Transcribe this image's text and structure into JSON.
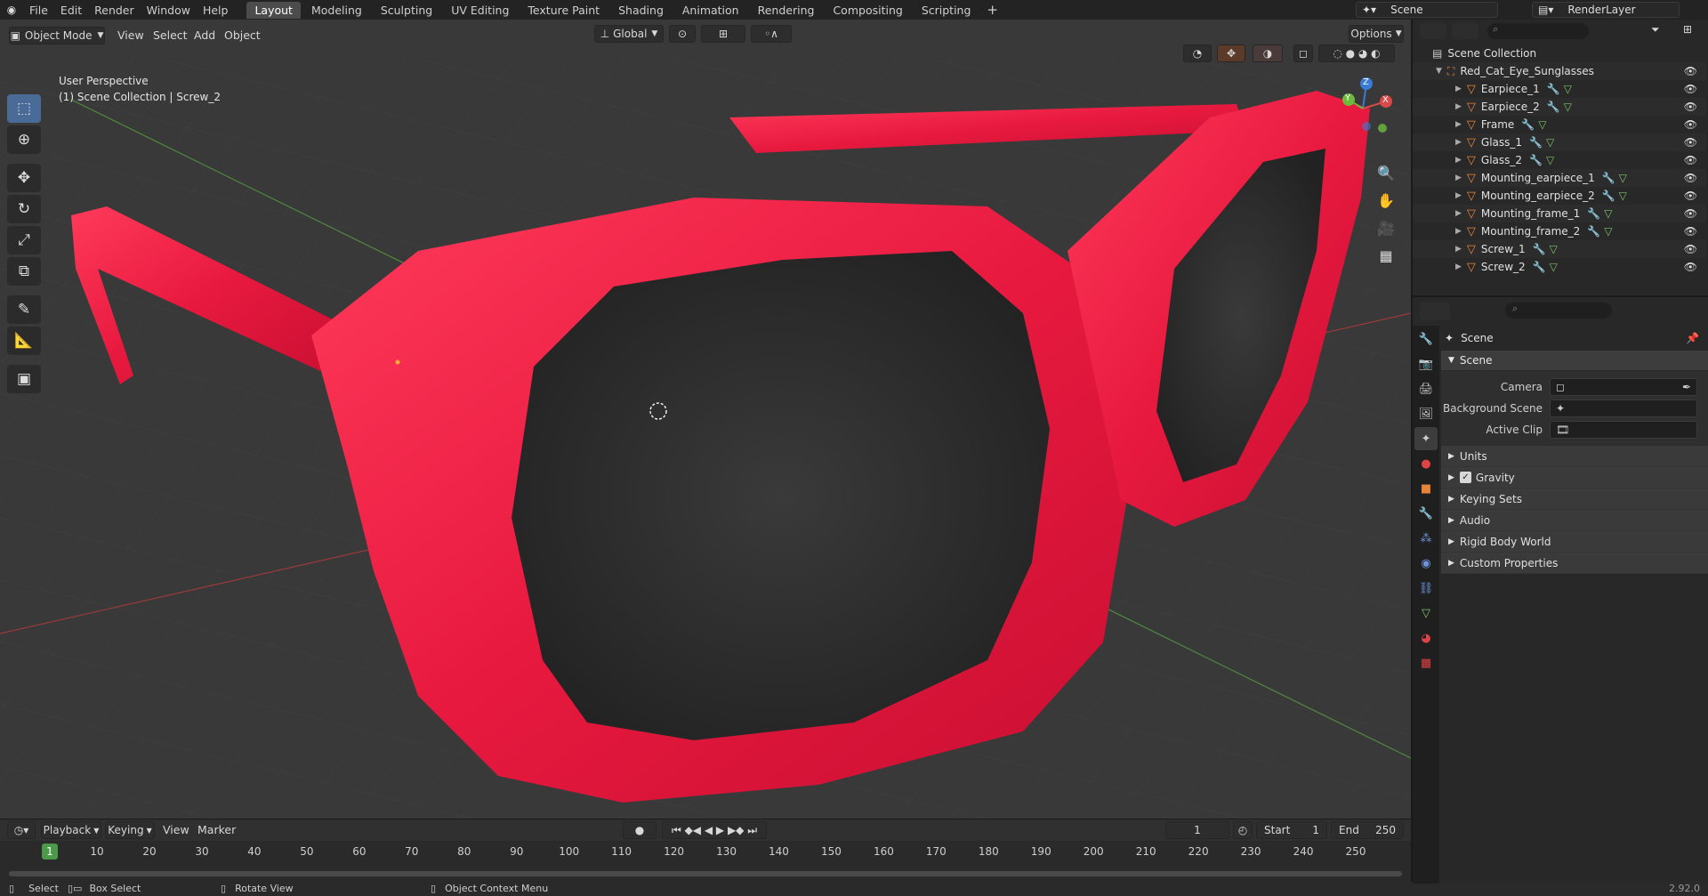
{
  "menus": [
    "File",
    "Edit",
    "Render",
    "Window",
    "Help"
  ],
  "workspaces": [
    "Layout",
    "Modeling",
    "Sculpting",
    "UV Editing",
    "Texture Paint",
    "Shading",
    "Animation",
    "Rendering",
    "Compositing",
    "Scripting"
  ],
  "active_workspace": "Layout",
  "scene_name": "Scene",
  "view_layer": "RenderLayer",
  "viewport": {
    "mode": "Object Mode",
    "menus": [
      "View",
      "Select",
      "Add",
      "Object"
    ],
    "orientation": "Global",
    "options_label": "Options",
    "overlay_line1": "User Perspective",
    "overlay_line2": "(1) Scene Collection | Screw_2",
    "gizmo_axes": {
      "z": "Z",
      "y": "Y",
      "x": "X"
    }
  },
  "timeline": {
    "menus": [
      "Playback",
      "Keying",
      "View",
      "Marker"
    ],
    "current_frame": "1",
    "start_label": "Start",
    "start": "1",
    "end_label": "End",
    "end": "250",
    "ticks": [
      "1",
      "10",
      "20",
      "30",
      "40",
      "50",
      "60",
      "70",
      "80",
      "90",
      "100",
      "110",
      "120",
      "130",
      "140",
      "150",
      "160",
      "170",
      "180",
      "190",
      "200",
      "210",
      "220",
      "230",
      "240",
      "250"
    ]
  },
  "statusbar": {
    "select": "Select",
    "box_select": "Box Select",
    "rotate_view": "Rotate View",
    "context_menu": "Object Context Menu",
    "version": "2.92.0"
  },
  "outliner": {
    "root": "Scene Collection",
    "collection": "Red_Cat_Eye_Sunglasses",
    "objects": [
      "Earpiece_1",
      "Earpiece_2",
      "Frame",
      "Glass_1",
      "Glass_2",
      "Mounting_earpiece_1",
      "Mounting_earpiece_2",
      "Mounting_frame_1",
      "Mounting_frame_2",
      "Screw_1",
      "Screw_2"
    ]
  },
  "properties": {
    "context": "Scene",
    "panel": "Scene",
    "fields": [
      {
        "label": "Camera"
      },
      {
        "label": "Background Scene"
      },
      {
        "label": "Active Clip"
      }
    ],
    "sub_panels": [
      "Units",
      "Gravity",
      "Keying Sets",
      "Audio",
      "Rigid Body World",
      "Custom Properties"
    ],
    "gravity_checked": true
  },
  "colors": {
    "frame_red": "#e8193f",
    "lens_dark": "#2a2a2a",
    "viewport_bg": "#393939",
    "accent_blue": "#4a6b98",
    "mesh_orange": "#e8843a"
  }
}
